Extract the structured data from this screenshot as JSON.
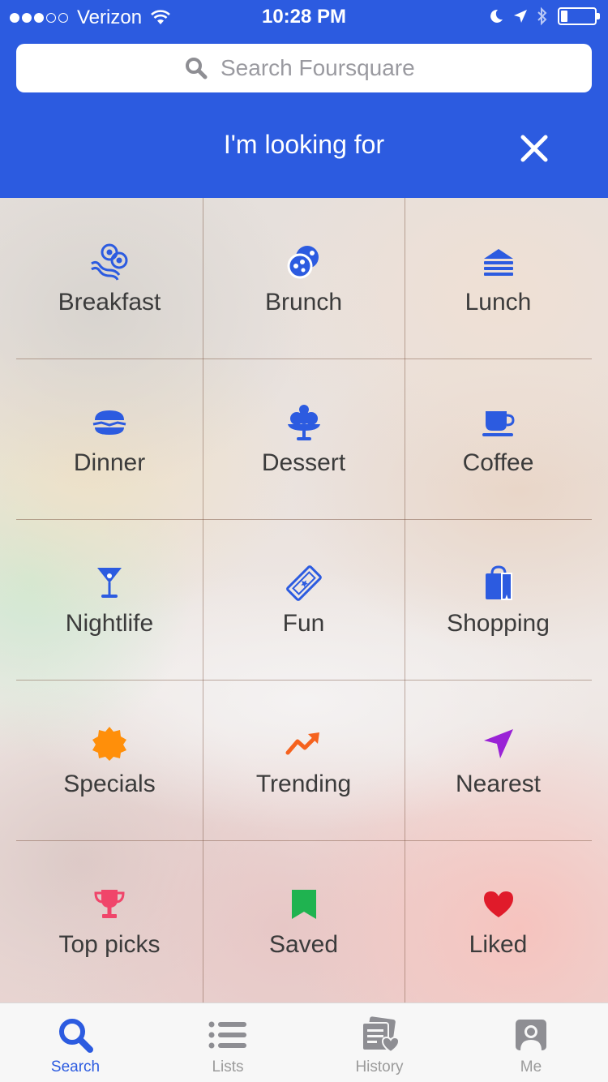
{
  "status_bar": {
    "carrier": "Verizon",
    "time": "10:28 PM",
    "signal_bars_filled": 3,
    "signal_bars_total": 5,
    "battery_level": 0.2
  },
  "search": {
    "placeholder": "Search Foursquare",
    "icon": "search-icon"
  },
  "panel": {
    "title": "I'm looking for",
    "close_icon": "close-icon"
  },
  "categories": [
    {
      "label": "Breakfast",
      "icon": "breakfast-icon",
      "color": "#2c5be0"
    },
    {
      "label": "Brunch",
      "icon": "brunch-icon",
      "color": "#2c5be0"
    },
    {
      "label": "Lunch",
      "icon": "lunch-sandwich-icon",
      "color": "#2c5be0"
    },
    {
      "label": "Dinner",
      "icon": "dinner-burger-icon",
      "color": "#2c5be0"
    },
    {
      "label": "Dessert",
      "icon": "dessert-icecream-icon",
      "color": "#2c5be0"
    },
    {
      "label": "Coffee",
      "icon": "coffee-cup-icon",
      "color": "#2c5be0"
    },
    {
      "label": "Nightlife",
      "icon": "cocktail-icon",
      "color": "#2c5be0"
    },
    {
      "label": "Fun",
      "icon": "ticket-icon",
      "color": "#2c5be0"
    },
    {
      "label": "Shopping",
      "icon": "shopping-bag-icon",
      "color": "#2c5be0"
    },
    {
      "label": "Specials",
      "icon": "specials-badge-icon",
      "color": "#ff8f0a"
    },
    {
      "label": "Trending",
      "icon": "trending-arrow-icon",
      "color": "#f5621e"
    },
    {
      "label": "Nearest",
      "icon": "location-arrow-icon",
      "color": "#9a22d6"
    },
    {
      "label": "Top picks",
      "icon": "trophy-icon",
      "color": "#f0456a"
    },
    {
      "label": "Saved",
      "icon": "bookmark-icon",
      "color": "#1fb350"
    },
    {
      "label": "Liked",
      "icon": "heart-icon",
      "color": "#e01b2a"
    }
  ],
  "tabs": [
    {
      "label": "Search",
      "icon": "search-icon",
      "active": true
    },
    {
      "label": "Lists",
      "icon": "list-icon",
      "active": false
    },
    {
      "label": "History",
      "icon": "history-icon",
      "active": false
    },
    {
      "label": "Me",
      "icon": "profile-icon",
      "active": false
    }
  ],
  "colors": {
    "brand_blue": "#2c5be0",
    "tab_inactive": "#9b9b9b"
  }
}
